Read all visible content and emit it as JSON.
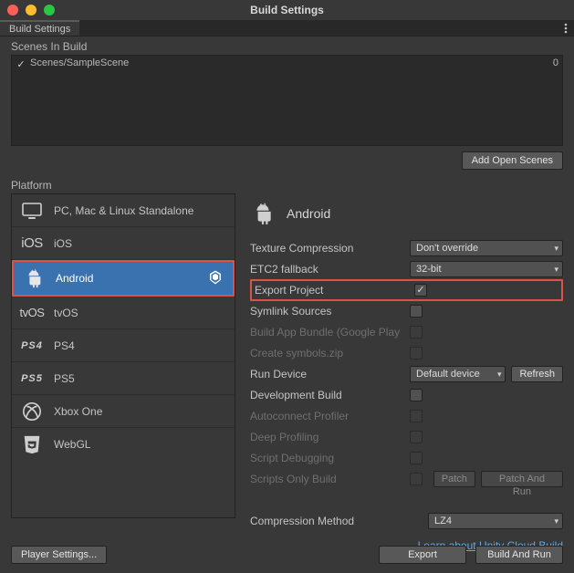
{
  "window": {
    "title": "Build Settings"
  },
  "tab": {
    "label": "Build Settings"
  },
  "scenes": {
    "header": "Scenes In Build",
    "add_button": "Add Open Scenes",
    "items": [
      {
        "checked": true,
        "path": "Scenes/SampleScene",
        "index": "0"
      }
    ]
  },
  "platforms": {
    "header": "Platform",
    "items": [
      {
        "id": "standalone",
        "label": "PC, Mac & Linux Standalone"
      },
      {
        "id": "ios",
        "label": "iOS"
      },
      {
        "id": "android",
        "label": "Android",
        "active": true
      },
      {
        "id": "tvos",
        "label": "tvOS"
      },
      {
        "id": "ps4",
        "label": "PS4"
      },
      {
        "id": "ps5",
        "label": "PS5"
      },
      {
        "id": "xboxone",
        "label": "Xbox One"
      },
      {
        "id": "webgl",
        "label": "WebGL"
      }
    ]
  },
  "details": {
    "title": "Android",
    "texture_compression": {
      "label": "Texture Compression",
      "value": "Don't override"
    },
    "etc2_fallback": {
      "label": "ETC2 fallback",
      "value": "32-bit"
    },
    "export_project": {
      "label": "Export Project",
      "checked": true
    },
    "symlink_sources": {
      "label": "Symlink Sources",
      "checked": false
    },
    "build_app_bundle": {
      "label": "Build App Bundle (Google Play",
      "checked": false
    },
    "create_symbols": {
      "label": "Create symbols.zip",
      "checked": false
    },
    "run_device": {
      "label": "Run Device",
      "value": "Default device",
      "refresh": "Refresh"
    },
    "development_build": {
      "label": "Development Build",
      "checked": false
    },
    "autoconnect_profiler": {
      "label": "Autoconnect Profiler",
      "checked": false
    },
    "deep_profiling": {
      "label": "Deep Profiling",
      "checked": false
    },
    "script_debugging": {
      "label": "Script Debugging",
      "checked": false
    },
    "scripts_only_build": {
      "label": "Scripts Only Build",
      "checked": false,
      "patch": "Patch",
      "patch_and_run": "Patch And Run"
    },
    "compression_method": {
      "label": "Compression Method",
      "value": "LZ4"
    },
    "learn_link": "Learn about Unity Cloud Build"
  },
  "footer": {
    "player_settings": "Player Settings...",
    "export": "Export",
    "build_and_run": "Build And Run"
  }
}
